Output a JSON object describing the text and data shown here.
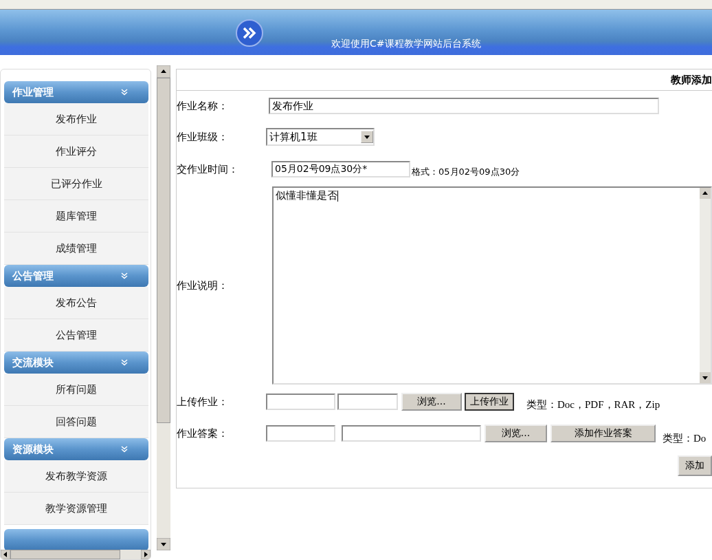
{
  "header": {
    "title": "欢迎使用C#课程教学网站后台系统"
  },
  "sidebar": {
    "groups": [
      {
        "title": "作业管理",
        "items": [
          "发布作业",
          "作业评分",
          "已评分作业",
          "题库管理",
          "成绩管理"
        ]
      },
      {
        "title": "公告管理",
        "items": [
          "发布公告",
          "公告管理"
        ]
      },
      {
        "title": "交流模块",
        "items": [
          "所有问题",
          "回答问题"
        ]
      },
      {
        "title": "资源模块",
        "items": [
          "发布教学资源",
          "教学资源管理"
        ]
      }
    ]
  },
  "form": {
    "title": "教师添加",
    "fields": [
      {
        "kind": "text",
        "label": "作业名称：",
        "value": "发布作业"
      },
      {
        "kind": "select",
        "label": "作业班级：",
        "value": "计算机1班"
      },
      {
        "kind": "time",
        "label": "交作业时间：",
        "value": "05月02号09点30分*",
        "hint": "格式：05月02号09点30分"
      },
      {
        "kind": "textarea",
        "label": "作业说明：",
        "value": "似懂非懂是否"
      },
      {
        "kind": "upload",
        "label": "上传作业：",
        "browse": "浏览...",
        "action": "上传作业",
        "hint": "类型：Doc，PDF，RAR，Zip"
      },
      {
        "kind": "answer",
        "label": "作业答案：",
        "browse": "浏览...",
        "action": "添加作业答案",
        "hint": "类型：Do"
      }
    ],
    "submit": "添加"
  }
}
